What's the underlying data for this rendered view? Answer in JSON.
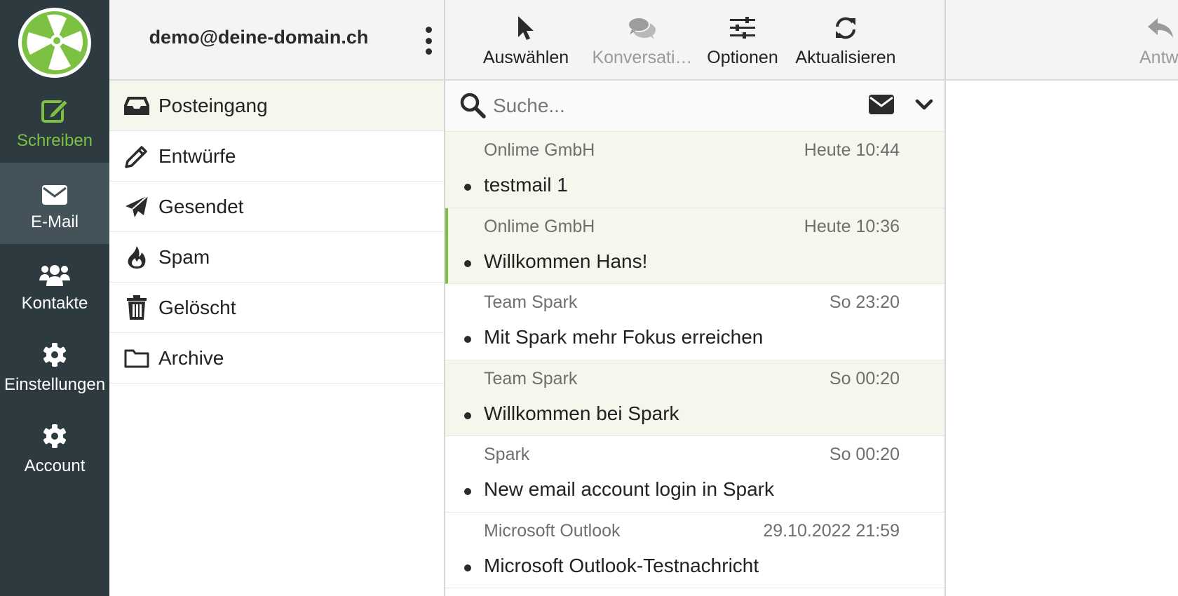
{
  "rail": {
    "items": [
      {
        "label": "Schreiben",
        "icon": "compose-icon"
      },
      {
        "label": "E-Mail",
        "icon": "envelope-icon"
      },
      {
        "label": "Kontakte",
        "icon": "users-icon"
      },
      {
        "label": "Einstellungen",
        "icon": "gear-icon"
      },
      {
        "label": "Account",
        "icon": "gear-icon"
      }
    ]
  },
  "account": {
    "email": "demo@deine-domain.ch"
  },
  "folders": [
    {
      "label": "Posteingang",
      "icon": "inbox-icon"
    },
    {
      "label": "Entwürfe",
      "icon": "pencil-icon"
    },
    {
      "label": "Gesendet",
      "icon": "paper-plane-icon"
    },
    {
      "label": "Spam",
      "icon": "fire-icon"
    },
    {
      "label": "Gelöscht",
      "icon": "trash-icon"
    },
    {
      "label": "Archive",
      "icon": "folder-icon"
    }
  ],
  "toolbar": {
    "select_label": "Auswählen",
    "conversation_label": "Konversati…",
    "options_label": "Optionen",
    "refresh_label": "Aktualisieren",
    "reply_label": "Antw"
  },
  "search": {
    "placeholder": "Suche..."
  },
  "messages": [
    {
      "sender": "Onlime GmbH",
      "date": "Heute 10:44",
      "subject": "testmail 1"
    },
    {
      "sender": "Onlime GmbH",
      "date": "Heute 10:36",
      "subject": "Willkommen Hans!"
    },
    {
      "sender": "Team Spark",
      "date": "So 23:20",
      "subject": "Mit Spark mehr Fokus erreichen"
    },
    {
      "sender": "Team Spark",
      "date": "So 00:20",
      "subject": "Willkommen bei Spark"
    },
    {
      "sender": "Spark",
      "date": "So 00:20",
      "subject": "New email account login in Spark"
    },
    {
      "sender": "Microsoft Outlook",
      "date": "29.10.2022 21:59",
      "subject": "Microsoft Outlook-Testnachricht"
    }
  ],
  "colors": {
    "rail_bg": "#2d3a3f",
    "rail_active": "#44535a",
    "accent_green": "#7cc142",
    "unread_bg": "#f3f7ec"
  }
}
